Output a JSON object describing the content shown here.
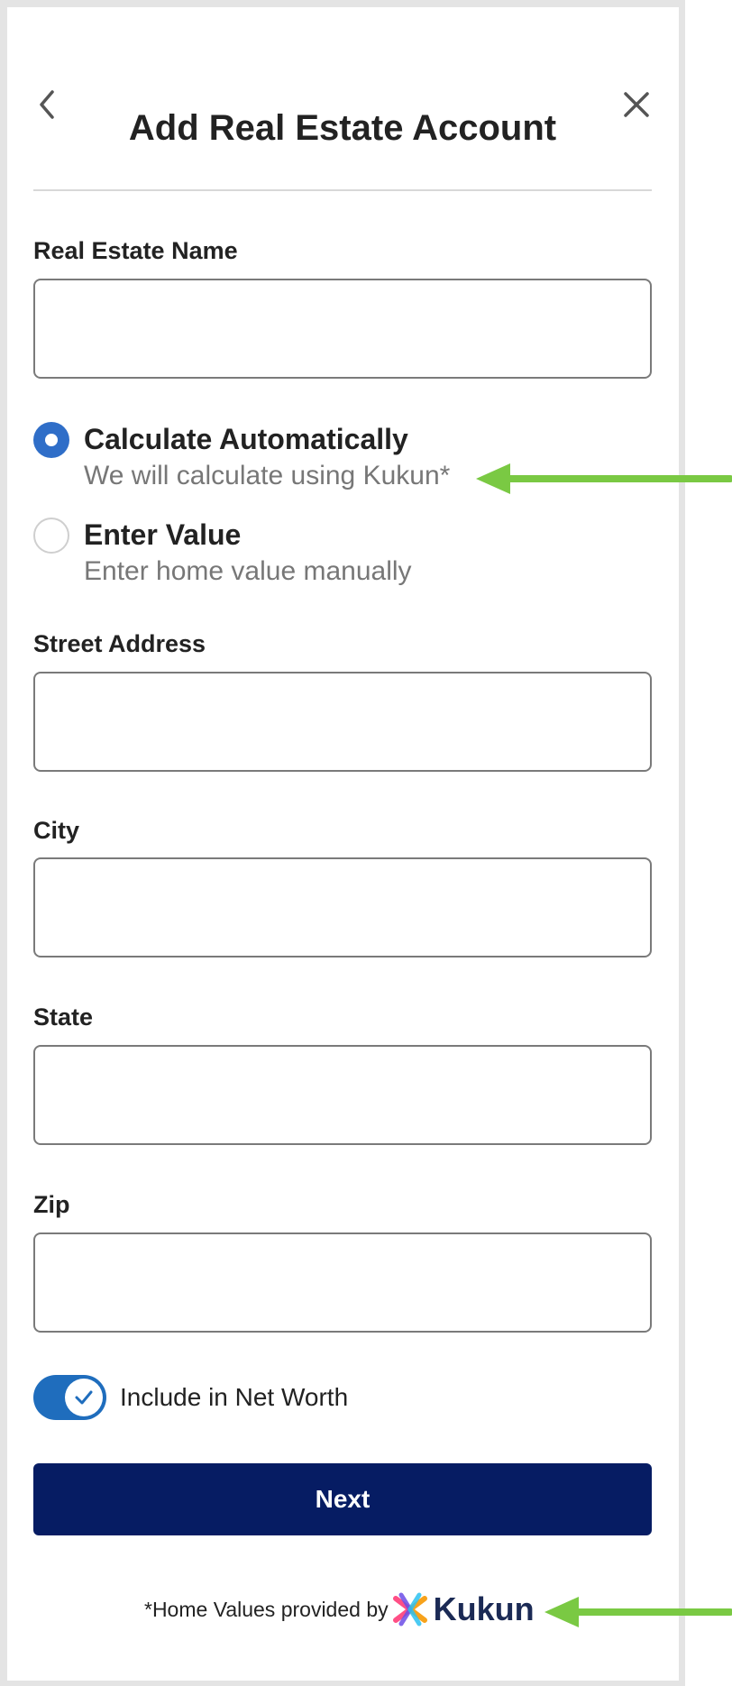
{
  "header": {
    "title": "Add Real Estate Account",
    "back_icon": "chevron-left-icon",
    "close_icon": "close-icon"
  },
  "form": {
    "real_estate_name": {
      "label": "Real Estate Name",
      "value": ""
    },
    "valuation_options": [
      {
        "title": "Calculate Automatically",
        "subtitle": "We will calculate using Kukun*",
        "selected": true
      },
      {
        "title": "Enter Value",
        "subtitle": "Enter home value manually",
        "selected": false
      }
    ],
    "street_address": {
      "label": "Street Address",
      "value": ""
    },
    "city": {
      "label": "City",
      "value": ""
    },
    "state": {
      "label": "State",
      "value": ""
    },
    "zip": {
      "label": "Zip",
      "value": ""
    },
    "include_net_worth": {
      "label": "Include in Net Worth",
      "checked": true
    },
    "next_label": "Next"
  },
  "footer": {
    "text": "*Home Values provided by",
    "brand": "Kukun"
  },
  "colors": {
    "accent": "#2f6ec8",
    "toggle": "#1f6dbd",
    "primary_button": "#061c63",
    "annotation_arrow": "#7ac943"
  }
}
